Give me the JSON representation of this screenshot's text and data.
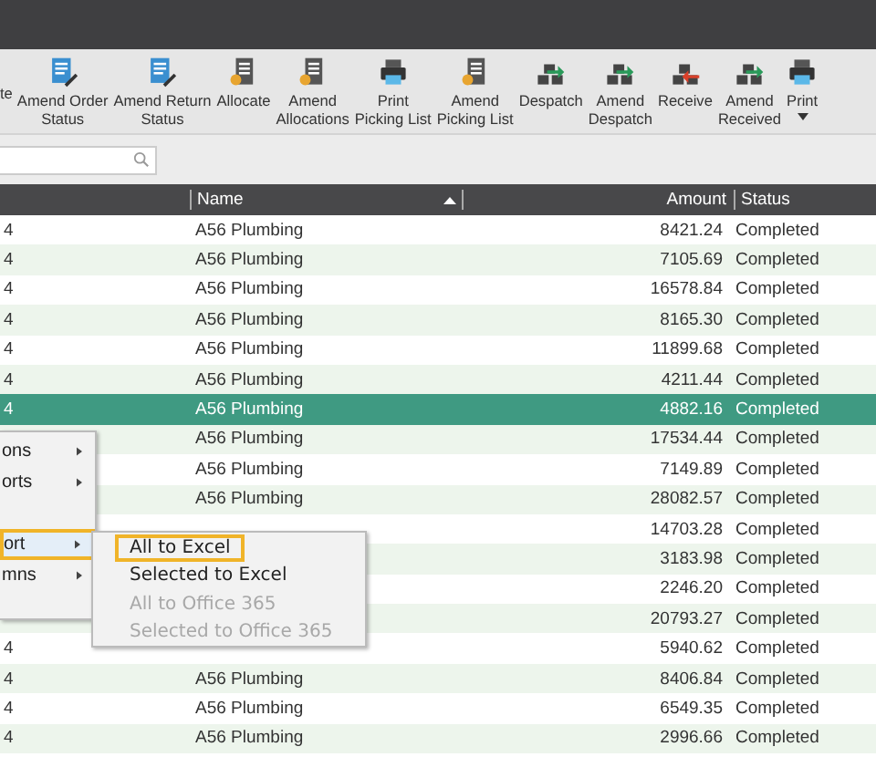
{
  "toolbar": [
    {
      "label": "te",
      "kind": "plain"
    },
    {
      "label": "Amend Order\nStatus",
      "kind": "edit"
    },
    {
      "label": "Amend Return\nStatus",
      "kind": "edit"
    },
    {
      "label": "Allocate",
      "kind": "list"
    },
    {
      "label": "Amend\nAllocations",
      "kind": "list"
    },
    {
      "label": "Print\nPicking List",
      "kind": "printer"
    },
    {
      "label": "Amend\nPicking List",
      "kind": "list"
    },
    {
      "label": "Despatch",
      "kind": "despatch"
    },
    {
      "label": "Amend\nDespatch",
      "kind": "despatch"
    },
    {
      "label": "Receive",
      "kind": "receive"
    },
    {
      "label": "Amend\nReceived",
      "kind": "despatch"
    },
    {
      "label": "Print",
      "kind": "printer",
      "dropdown": true
    }
  ],
  "table": {
    "columns": [
      "Name",
      "Amount",
      "Status"
    ],
    "rows": [
      {
        "column_1": "4",
        "name": "A56 Plumbing",
        "amount": "8421.24",
        "status": "Completed",
        "selected": false
      },
      {
        "column_1": "4",
        "name": "A56 Plumbing",
        "amount": "7105.69",
        "status": "Completed",
        "selected": false
      },
      {
        "column_1": "4",
        "name": "A56 Plumbing",
        "amount": "16578.84",
        "status": "Completed",
        "selected": false
      },
      {
        "column_1": "4",
        "name": "A56 Plumbing",
        "amount": "8165.30",
        "status": "Completed",
        "selected": false
      },
      {
        "column_1": "4",
        "name": "A56 Plumbing",
        "amount": "11899.68",
        "status": "Completed",
        "selected": false
      },
      {
        "column_1": "4",
        "name": "A56 Plumbing",
        "amount": "4211.44",
        "status": "Completed",
        "selected": false
      },
      {
        "column_1": "4",
        "name": "A56 Plumbing",
        "amount": "4882.16",
        "status": "Completed",
        "selected": true
      },
      {
        "name": "A56 Plumbing",
        "amount": "17534.44",
        "status": "Completed",
        "selected": false
      },
      {
        "name": "A56 Plumbing",
        "amount": "7149.89",
        "status": "Completed",
        "selected": false
      },
      {
        "name": "A56 Plumbing",
        "amount": "28082.57",
        "status": "Completed",
        "selected": false
      },
      {
        "amount": "14703.28",
        "status": "Completed",
        "selected": false
      },
      {
        "amount": "3183.98",
        "status": "Completed",
        "selected": false
      },
      {
        "amount": "2246.20",
        "status": "Completed",
        "selected": false
      },
      {
        "amount": "20793.27",
        "status": "Completed",
        "selected": false
      },
      {
        "column_1": "4",
        "amount": "5940.62",
        "status": "Completed",
        "selected": false
      },
      {
        "column_1": "4",
        "name": "A56 Plumbing",
        "amount": "8406.84",
        "status": "Completed",
        "selected": false
      },
      {
        "column_1": "4",
        "name": "A56 Plumbing",
        "amount": "6549.35",
        "status": "Completed",
        "selected": false
      },
      {
        "column_1": "4",
        "name": "A56 Plumbing",
        "amount": "2996.66",
        "status": "Completed",
        "selected": false
      }
    ]
  },
  "context_menu": {
    "items": [
      {
        "label": "ons",
        "selected": false
      },
      {
        "label": "orts",
        "selected": false
      },
      {
        "label": "ort",
        "selected": true
      },
      {
        "label": "mns",
        "selected": false
      }
    ]
  },
  "submenu": {
    "items": [
      {
        "label": "All to Excel",
        "selected": true,
        "disabled": false
      },
      {
        "label": "Selected to Excel",
        "selected": false,
        "disabled": false
      },
      {
        "label": "All to Office 365",
        "selected": false,
        "disabled": true
      },
      {
        "label": "Selected to Office 365",
        "selected": false,
        "disabled": true
      }
    ]
  }
}
